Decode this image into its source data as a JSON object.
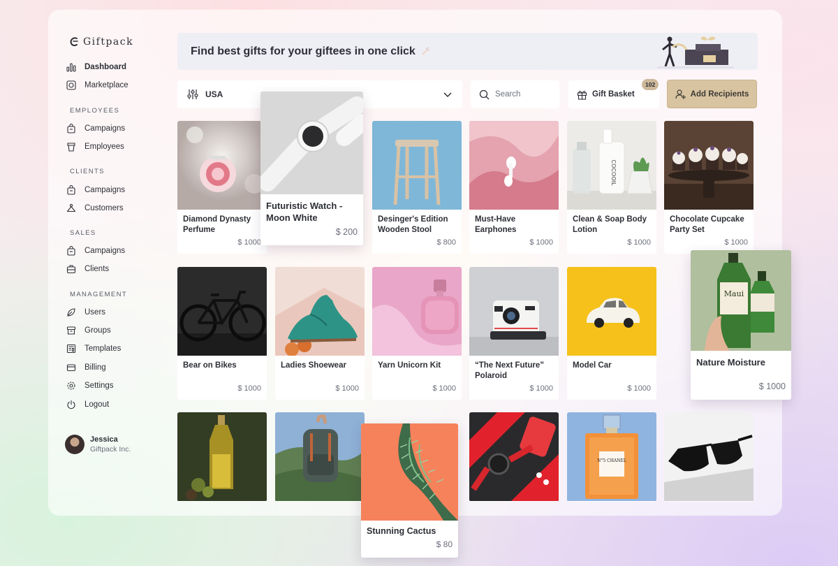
{
  "app": {
    "brand": "Giftpack"
  },
  "sidebar": {
    "nav": [
      {
        "label": "Dashboard"
      },
      {
        "label": "Marketplace"
      }
    ],
    "sections": [
      {
        "title": "EMPLOYEES",
        "items": [
          {
            "label": "Campaigns"
          },
          {
            "label": "Employees"
          }
        ]
      },
      {
        "title": "CLIENTS",
        "items": [
          {
            "label": "Campaigns"
          },
          {
            "label": "Customers"
          }
        ]
      },
      {
        "title": "SALES",
        "items": [
          {
            "label": "Campaigns"
          },
          {
            "label": "Clients"
          }
        ]
      },
      {
        "title": "MANAGEMENT",
        "items": [
          {
            "label": "Users"
          },
          {
            "label": "Groups"
          },
          {
            "label": "Templates"
          },
          {
            "label": "Billing"
          },
          {
            "label": "Settings"
          },
          {
            "label": "Logout"
          }
        ]
      }
    ],
    "user": {
      "name": "Jessica",
      "org": "Giftpack Inc."
    }
  },
  "banner": {
    "text": "Find best gifts for your giftees in one click"
  },
  "toolbar": {
    "country": "USA",
    "search_placeholder": "Search",
    "basket_label": "Gift Basket",
    "basket_count": "102",
    "add_recipients_label": "Add Recipients"
  },
  "products": [
    {
      "name": "Diamond Dynasty Perfume",
      "price": "$ 1000",
      "icon": "perfume-bottle"
    },
    {
      "name": "Futuristic Watch - Moon White",
      "price": "$ 200",
      "icon": "smart-watch"
    },
    {
      "name": "Desinger's Edition Wooden Stool",
      "price": "$ 800",
      "icon": "wooden-stool"
    },
    {
      "name": "Must-Have Earphones",
      "price": "$ 1000",
      "icon": "earphones"
    },
    {
      "name": "Clean & Soap Body Lotion",
      "price": "$ 1000",
      "icon": "lotion-bottles",
      "product_label": "COCOOIL"
    },
    {
      "name": "Chocolate Cupcake Party Set",
      "price": "$ 1000",
      "icon": "cupcakes"
    },
    {
      "name": "Bear on Bikes",
      "price": "$ 1000",
      "icon": "bicycle"
    },
    {
      "name": "Ladies Shoewear",
      "price": "$ 1000",
      "icon": "shoe"
    },
    {
      "name": "Yarn Unicorn Kit",
      "price": "$ 1000",
      "icon": "pink-perfume"
    },
    {
      "name": "“The Next Future” Polaroid",
      "price": "$ 1000",
      "icon": "polaroid-camera"
    },
    {
      "name": "Model Car",
      "price": "$ 1000",
      "icon": "toy-car"
    },
    {
      "name": "Nature Moisture",
      "price": "$ 1000",
      "icon": "green-bottles",
      "product_label": "Maui"
    },
    {
      "name": "",
      "price": "",
      "icon": "olive-oil"
    },
    {
      "name": "",
      "price": "",
      "icon": "backpack"
    },
    {
      "name": "Stunning Cactus",
      "price": "$ 80",
      "icon": "cactus"
    },
    {
      "name": "",
      "price": "",
      "icon": "red-gadgets"
    },
    {
      "name": "",
      "price": "",
      "icon": "chanel-perfume",
      "product_label": "N°5 CHANEL"
    },
    {
      "name": "",
      "price": "",
      "icon": "sunglasses"
    }
  ]
}
